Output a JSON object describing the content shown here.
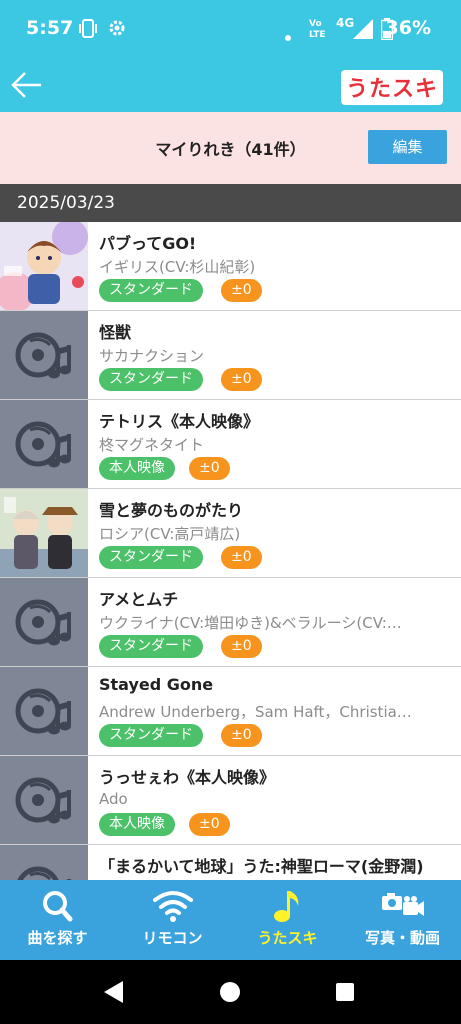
{
  "status_bar": {
    "time": "5:57",
    "network": "4G",
    "battery": "36%",
    "icons": [
      "sim-icon",
      "settings-icon",
      "dot-icon",
      "volte-icon",
      "signal-icon",
      "battery-icon"
    ]
  },
  "header": {
    "back_icon": "arrow-left-icon",
    "logo": "うたスキ"
  },
  "history": {
    "title": "マイりれき（41件）",
    "edit_label": "編集"
  },
  "date_label": "2025/03/23",
  "songs": [
    {
      "title": "パブってGO!",
      "artist": "イギリス(CV:杉山紀彰)",
      "type": "スタンダード",
      "key": "±0",
      "thumb": "artwork"
    },
    {
      "title": "怪獣",
      "artist": "サカナクション",
      "type": "スタンダード",
      "key": "±0",
      "thumb": "music-disc"
    },
    {
      "title": "テトリス《本人映像》",
      "artist": "柊マグネタイト",
      "type": "本人映像",
      "key": "±0",
      "thumb": "music-disc"
    },
    {
      "title": "雪と夢のものがたり",
      "artist": "ロシア(CV:高戸靖広)",
      "type": "スタンダード",
      "key": "±0",
      "thumb": "artwork"
    },
    {
      "title": "アメとムチ",
      "artist": "ウクライナ(CV:増田ゆき)&ベラルーシ(CV:…",
      "type": "スタンダード",
      "key": "±0",
      "thumb": "music-disc"
    },
    {
      "title": "Stayed Gone",
      "artist": "Andrew Underberg，Sam Haft，Christia…",
      "type": "スタンダード",
      "key": "±0",
      "thumb": "music-disc"
    },
    {
      "title": "うっせぇわ《本人映像》",
      "artist": "Ado",
      "type": "本人映像",
      "key": "±0",
      "thumb": "music-disc"
    },
    {
      "title": "「まるかいて地球」うた:神聖ローマ(金野潤)",
      "artist": "",
      "type": "",
      "key": "",
      "thumb": "music-disc"
    }
  ],
  "nav": [
    {
      "label": "曲を探す",
      "icon": "search-icon",
      "active": false
    },
    {
      "label": "リモコン",
      "icon": "wifi-icon",
      "active": false
    },
    {
      "label": "うたスキ",
      "icon": "music-note-icon",
      "active": true
    },
    {
      "label": "写真・動画",
      "icon": "camera-video-icon",
      "active": false
    }
  ],
  "system_nav": [
    "back-triangle-icon",
    "home-circle-icon",
    "recents-square-icon"
  ],
  "colors": {
    "primary": "#3cc8e3",
    "nav": "#3aa3dd",
    "standard_tag": "#4cc16a",
    "key_tag": "#f7941d",
    "active_nav": "#fff22a",
    "history_bg": "#fbe3e3"
  }
}
